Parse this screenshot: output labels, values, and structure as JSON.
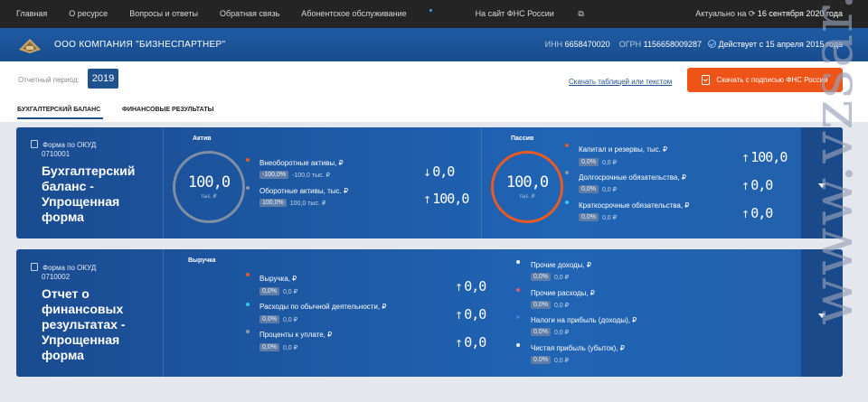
{
  "topnav": {
    "items": [
      "Главная",
      "О ресурсе",
      "Вопросы и ответы",
      "Обратная связь",
      "Абонентское обслуживание",
      "На сайт ФНС России"
    ],
    "actual_prefix": "Актуально на",
    "actual_date": "16 сентября 2020 года"
  },
  "company": {
    "name": "ООО КОМПАНИЯ \"БИЗНЕСПАРТНЕР\"",
    "inn_label": "ИНН",
    "inn": "6658470020",
    "ogrn_label": "ОГРН",
    "ogrn": "1156658009287",
    "status": "Действует с 15 апреля 2015 года"
  },
  "period": {
    "label": "Отчетный период:",
    "year": "2019",
    "table_link": "Скачать таблицей или текстом",
    "download_label": "Скачать с подписью ФНС России"
  },
  "tabs": [
    "БУХГАЛТЕРСКИЙ БАЛАНС",
    "ФИНАНСОВЫЕ РЕЗУЛЬТАТЫ"
  ],
  "card1": {
    "form_label": "Форма по ОКУД",
    "code": "0710001",
    "title": "Бухгалтерский баланс - Упрощенная форма",
    "asset": {
      "title": "Актив",
      "total": "100,0",
      "unit": "тыс. ₽",
      "items": [
        {
          "label": "Внеоборотные активы, ₽",
          "pct": "-100,0%",
          "val": "-100,0 тыс. ₽",
          "big": "0,0",
          "arrow": "↓",
          "color": "#ea5a22"
        },
        {
          "label": "Оборотные активы, тыс. ₽",
          "pct": "100,0%",
          "val": "100,0 тыс. ₽",
          "big": "100,0",
          "arrow": "↑",
          "color": "#8a98b0"
        }
      ]
    },
    "liab": {
      "title": "Пассив",
      "total": "100,0",
      "unit": "тыс. ₽",
      "items": [
        {
          "label": "Капитал и резервы, тыс. ₽",
          "pct": "0,0%",
          "val": "0,0 ₽",
          "big": "100,0",
          "arrow": "↑",
          "color": "#ea5a22"
        },
        {
          "label": "Долгосрочные обязательства, ₽",
          "pct": "0,0%",
          "val": "0,0 ₽",
          "big": "0,0",
          "arrow": "↑",
          "color": "#8a98b0"
        },
        {
          "label": "Краткосрочные обязательства, ₽",
          "pct": "0,0%",
          "val": "0,0 ₽",
          "big": "0,0",
          "arrow": "↑",
          "color": "#35c6e8"
        }
      ]
    }
  },
  "card2": {
    "form_label": "Форма по ОКУД",
    "code": "0710002",
    "title": "Отчет о финансовых результатах - Упрощенная форма",
    "rev_title": "Выручка",
    "left": [
      {
        "label": "Выручка, ₽",
        "pct": "0,0%",
        "val": "0,0 ₽",
        "big": "0,0",
        "arrow": "↑",
        "color": "#ea5a22"
      },
      {
        "label": "Расходы по обычной деятельности, ₽",
        "pct": "0,0%",
        "val": "0,0 ₽",
        "big": "0,0",
        "arrow": "↑",
        "color": "#35c6e8"
      },
      {
        "label": "Проценты к уплате, ₽",
        "pct": "0,0%",
        "val": "0,0 ₽",
        "big": "0,0",
        "arrow": "↑",
        "color": "#8a98b0"
      }
    ],
    "right": [
      {
        "label": "Прочие доходы, ₽",
        "pct": "0,0%",
        "val": "0,0 ₽",
        "color": "#ffffff"
      },
      {
        "label": "Прочие расходы, ₽",
        "pct": "0,0%",
        "val": "0,0 ₽",
        "color": "#e85a7a"
      },
      {
        "label": "Налоги на прибыль (доходы), ₽",
        "pct": "0,0%",
        "val": "0,0 ₽",
        "color": "#3a7ae0"
      },
      {
        "label": "Чистая прибыль (убыток), ₽",
        "pct": "0,0%",
        "val": "0,0 ₽",
        "color": "#ffffff"
      }
    ]
  },
  "watermark": "www.vzsar.ru"
}
